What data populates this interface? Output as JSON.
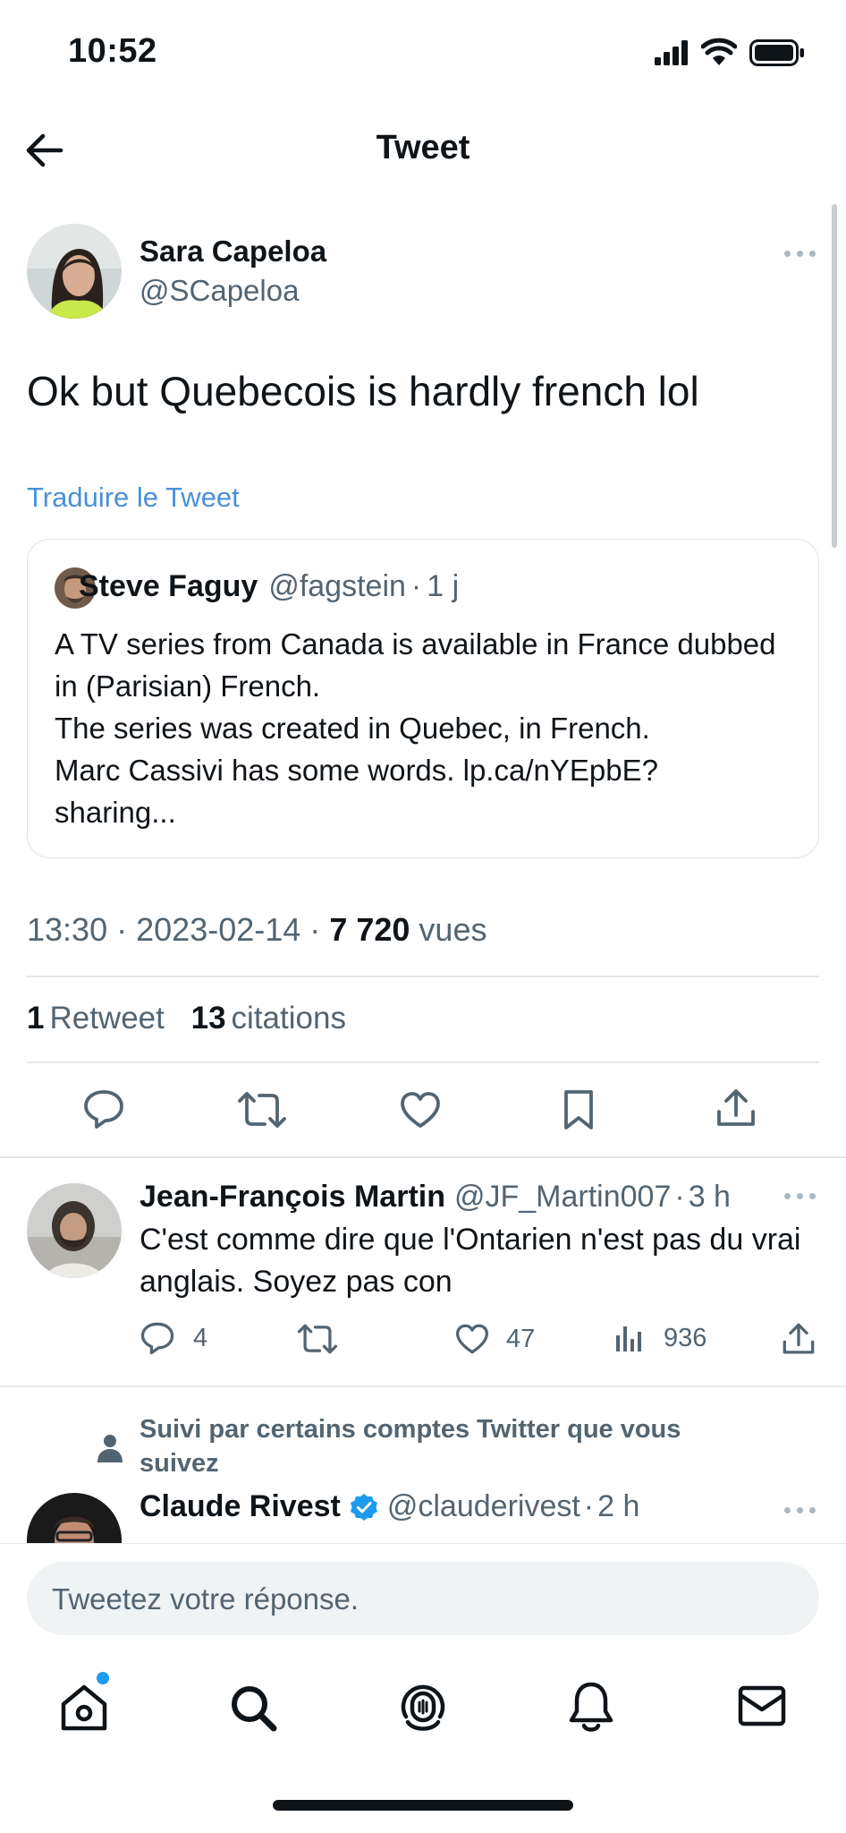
{
  "status_bar": {
    "time": "10:52"
  },
  "header": {
    "title": "Tweet"
  },
  "tweet": {
    "author_name": "Sara Capeloa",
    "author_handle": "@SCapeloa",
    "text": "Ok but Quebecois is hardly french lol",
    "translate_label": "Traduire le Tweet",
    "quote": {
      "author_name": "Steve Faguy",
      "author_handle": "@fagstein",
      "separator": "·",
      "time": "1 j",
      "text": "A TV series from Canada is available in France dubbed in (Parisian) French.\nThe series was created in Quebec, in French.\nMarc Cassivi has some words. lp.ca/nYEpbE?\nsharing..."
    },
    "time": "13:30",
    "date": "2023-02-14",
    "separator": "·",
    "views_count": "7 720",
    "views_label": "vues",
    "retweets_count": "1",
    "retweets_label": "Retweet",
    "quotes_count": "13",
    "quotes_label": "citations"
  },
  "replies": [
    {
      "author_name": "Jean-François Martin",
      "author_handle": "@JF_Martin007",
      "separator": "·",
      "time": "3 h",
      "text": "C'est comme dire que l'Ontarien n'est pas du vrai anglais. Soyez pas con",
      "reply_count": "4",
      "like_count": "47",
      "views_count": "936"
    },
    {
      "social_context": "Suivi par certains comptes Twitter que vous suivez",
      "author_name": "Claude Rivest",
      "author_handle": "@clauderivest",
      "separator": "·",
      "time": "2 h"
    }
  ],
  "composer": {
    "placeholder": "Tweetez votre réponse."
  },
  "colors": {
    "accent": "#1d9bf0",
    "link": "#4a90d9",
    "text": "#0f1419",
    "secondary": "#536471"
  },
  "icons": [
    "back-arrow-icon",
    "more-icon",
    "reply-icon",
    "retweet-icon",
    "like-icon",
    "bookmark-icon",
    "share-icon",
    "views-icon",
    "verified-icon",
    "person-icon",
    "home-icon",
    "search-icon",
    "spaces-icon",
    "notifications-icon",
    "messages-icon"
  ]
}
